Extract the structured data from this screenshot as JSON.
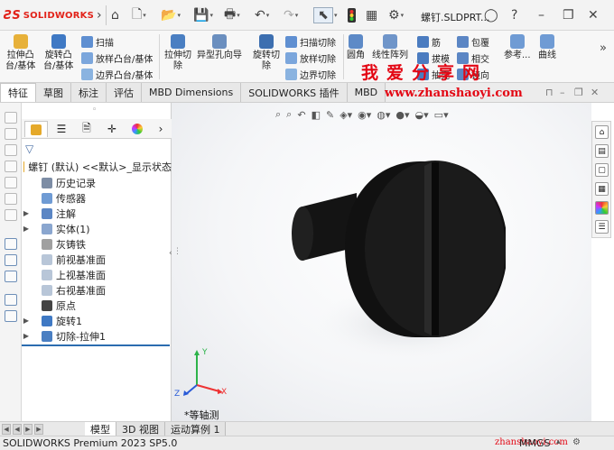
{
  "app": {
    "brand": "SOLIDWORKS",
    "document_title": "螺钉.SLDPRT..."
  },
  "ribbon": {
    "extrude_boss": "拉伸凸\n台/基体",
    "revolve_boss": "旋转凸\n台/基体",
    "sweep": "扫描",
    "loft_boss": "放样凸台/基体",
    "boundary_boss": "边界凸台/基体",
    "extrude_cut": "拉伸切\n除",
    "hole_wizard": "异型孔向导",
    "revolve_cut": "旋转切\n除",
    "sweep_cut": "扫描切除",
    "loft_cut": "放样切除",
    "boundary_cut": "边界切除",
    "fillet": "圆角",
    "linear_pattern": "线性阵列",
    "rib": "筋",
    "draft": "拔模",
    "shell": "抽壳",
    "wrap": "包覆",
    "intersect": "相交",
    "mirror": "镜向",
    "reference": "参考...",
    "curves": "曲线"
  },
  "tabs": [
    "特征",
    "草图",
    "标注",
    "评估",
    "MBD Dimensions",
    "SOLIDWORKS 插件",
    "MBD"
  ],
  "watermark": {
    "chars": "我爱分享网",
    "url": "www.zhanshaoyi.com",
    "corner": "zhanshaoyi.com"
  },
  "tree": {
    "root": "螺钉 (默认) <<默认>_显示状态",
    "items": [
      {
        "label": "历史记录",
        "expandable": false
      },
      {
        "label": "传感器",
        "expandable": false
      },
      {
        "label": "注解",
        "expandable": true
      },
      {
        "label": "实体(1)",
        "expandable": true
      },
      {
        "label": "灰铸铁",
        "expandable": false
      },
      {
        "label": "前视基准面",
        "expandable": false
      },
      {
        "label": "上视基准面",
        "expandable": false
      },
      {
        "label": "右视基准面",
        "expandable": false
      },
      {
        "label": "原点",
        "expandable": false
      },
      {
        "label": "旋转1",
        "expandable": true
      },
      {
        "label": "切除-拉伸1",
        "expandable": true
      }
    ]
  },
  "viewport": {
    "view_label": "*等轴测",
    "axis_x": "X",
    "axis_y": "Y",
    "axis_z": "Z"
  },
  "bottom_tabs": [
    "模型",
    "3D 视图",
    "运动算例 1"
  ],
  "status": {
    "product": "SOLIDWORKS Premium 2023 SP5.0",
    "units": "MMGS"
  },
  "colors": {
    "brand_red": "#e2231a",
    "accent_blue": "#2b6cb0",
    "part_color": "#1a1a1a"
  }
}
